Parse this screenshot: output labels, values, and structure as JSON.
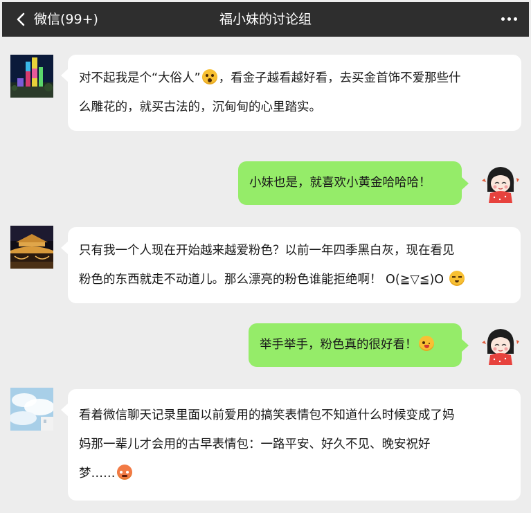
{
  "header": {
    "back_label": "微信(99+)",
    "title": "福小妹的讨论组",
    "icons": {
      "back": "chevron-left-icon",
      "more": "more-dots-icon"
    }
  },
  "messages": [
    {
      "side": "left",
      "avatar": "city-night-avatar",
      "lines": [
        "对不起我是个“大俗人”",
        "，看金子越看越好看，去买金首饰不爱那些什",
        "么雕花的，就买古法的，沉甸甸的心里踏实。"
      ],
      "emoji": "surprised-face-emoji"
    },
    {
      "side": "right",
      "avatar": "cartoon-girl-avatar",
      "text": "小妹也是，就喜欢小黄金哈哈哈！"
    },
    {
      "side": "left",
      "avatar": "bridge-night-avatar",
      "lines": [
        "只有我一个人现在开始越来越爱粉色？以前一年四季黑白灰，现在看见",
        "粉色的东西就走不动道儿。那么漂亮的粉色谁能拒绝啊！ O(≧▽≦)O"
      ],
      "emoji": "blushing-face-emoji"
    },
    {
      "side": "right",
      "avatar": "cartoon-girl-avatar",
      "text": "举手举手，粉色真的很好看！",
      "emoji": "winking-tongue-face-emoji"
    },
    {
      "side": "left",
      "avatar": "sky-avatar",
      "lines": [
        "看着微信聊天记录里面以前爱用的搞笑表情包不知道什么时候变成了妈",
        "妈那一辈儿才会用的古早表情包：一路平安、好久不见、晚安祝好",
        "梦……"
      ],
      "emoji": "overheated-face-emoji"
    }
  ],
  "colors": {
    "header_bg": "#2e2e2e",
    "chat_bg": "#ededed",
    "bubble_received": "#ffffff",
    "bubble_sent": "#95ec69",
    "text": "#191919"
  }
}
